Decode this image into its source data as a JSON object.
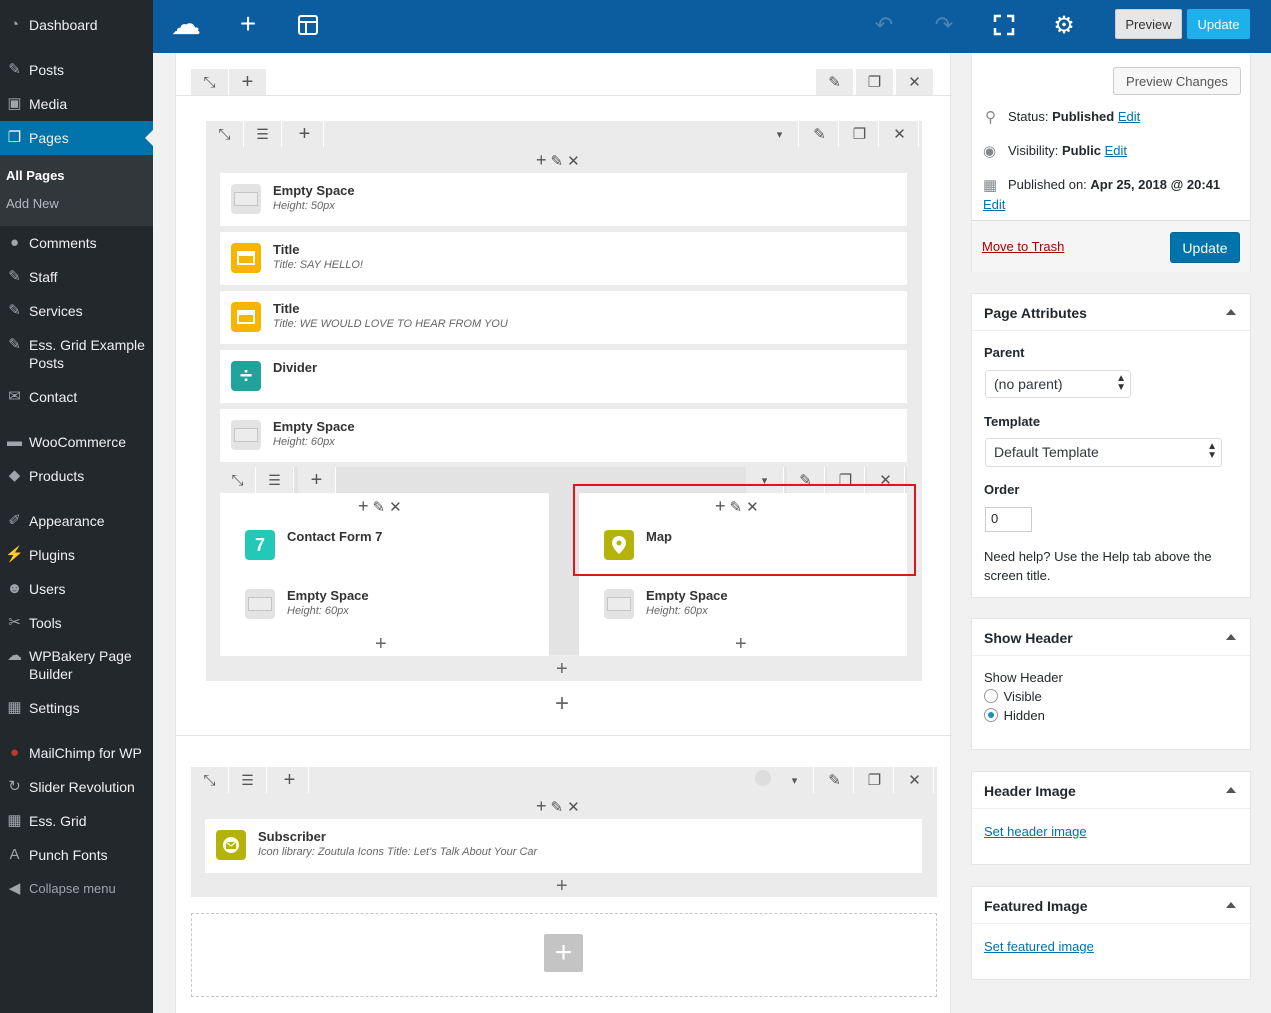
{
  "sidebar": {
    "items": [
      {
        "label": "Dashboard",
        "icon": "dashboard-icon"
      },
      {
        "label": "Posts",
        "icon": "pin-icon"
      },
      {
        "label": "Media",
        "icon": "media-icon"
      },
      {
        "label": "Pages",
        "icon": "pages-icon"
      },
      {
        "label": "Comments",
        "icon": "comment-icon"
      },
      {
        "label": "Staff",
        "icon": "pin-icon"
      },
      {
        "label": "Services",
        "icon": "pin-icon"
      },
      {
        "label": "Ess. Grid Example Posts",
        "icon": "pin-icon"
      },
      {
        "label": "Contact",
        "icon": "mail-icon"
      },
      {
        "label": "WooCommerce",
        "icon": "woo-icon"
      },
      {
        "label": "Products",
        "icon": "box-icon"
      },
      {
        "label": "Appearance",
        "icon": "brush-icon"
      },
      {
        "label": "Plugins",
        "icon": "plug-icon"
      },
      {
        "label": "Users",
        "icon": "user-icon"
      },
      {
        "label": "Tools",
        "icon": "wrench-icon"
      },
      {
        "label": "WPBakery Page Builder",
        "icon": "cloud-icon"
      },
      {
        "label": "Settings",
        "icon": "settings-icon"
      },
      {
        "label": "MailChimp for WP",
        "icon": "mailchimp-icon"
      },
      {
        "label": "Slider Revolution",
        "icon": "refresh-icon"
      },
      {
        "label": "Ess. Grid",
        "icon": "grid-icon"
      },
      {
        "label": "Punch Fonts",
        "icon": "font-icon"
      },
      {
        "label": "Collapse menu",
        "icon": "collapse-icon"
      }
    ],
    "submenu": {
      "all_pages": "All Pages",
      "add_new": "Add New"
    }
  },
  "toolbar": {
    "preview_label": "Preview",
    "update_label": "Update"
  },
  "builder": {
    "rows": [
      {
        "name": "Empty Space",
        "sub": "Height: 50px"
      },
      {
        "name": "Title",
        "sub": "Title: SAY HELLO!"
      },
      {
        "name": "Title",
        "sub": "Title: WE WOULD LOVE TO HEAR FROM YOU"
      },
      {
        "name": "Divider",
        "sub": ""
      },
      {
        "name": "Empty Space",
        "sub": "Height: 60px"
      }
    ],
    "inner": {
      "left": [
        {
          "name": "Contact Form 7",
          "sub": "",
          "badge": "7"
        },
        {
          "name": "Empty Space",
          "sub": "Height: 60px"
        }
      ],
      "right": [
        {
          "name": "Map",
          "sub": ""
        },
        {
          "name": "Empty Space",
          "sub": "Height: 60px"
        }
      ]
    },
    "subscriber": {
      "name": "Subscriber",
      "sub": "Icon library: Zoutula Icons  Title: Let's Talk About Your Car"
    }
  },
  "publish": {
    "preview_changes": "Preview Changes",
    "status_label": "Status:",
    "status_value": "Published",
    "visibility_label": "Visibility:",
    "visibility_value": "Public",
    "published_label": "Published on:",
    "published_value": "Apr 25, 2018 @ 20:41",
    "edit": "Edit",
    "move_to_trash": "Move to Trash",
    "update": "Update"
  },
  "page_attributes": {
    "title": "Page Attributes",
    "parent_label": "Parent",
    "parent_value": "(no parent)",
    "template_label": "Template",
    "template_value": "Default Template",
    "order_label": "Order",
    "order_value": "0",
    "help": "Need help? Use the Help tab above the screen title."
  },
  "show_header": {
    "title": "Show Header",
    "label": "Show Header",
    "visible": "Visible",
    "hidden": "Hidden",
    "selected": "Hidden"
  },
  "header_image": {
    "title": "Header Image",
    "link": "Set header image"
  },
  "featured_image": {
    "title": "Featured Image",
    "link": "Set featured image"
  },
  "colors": {
    "wp_blue": "#0073aa",
    "toolbar_blue": "#0b5d9f",
    "highlight": "#e0151b"
  }
}
